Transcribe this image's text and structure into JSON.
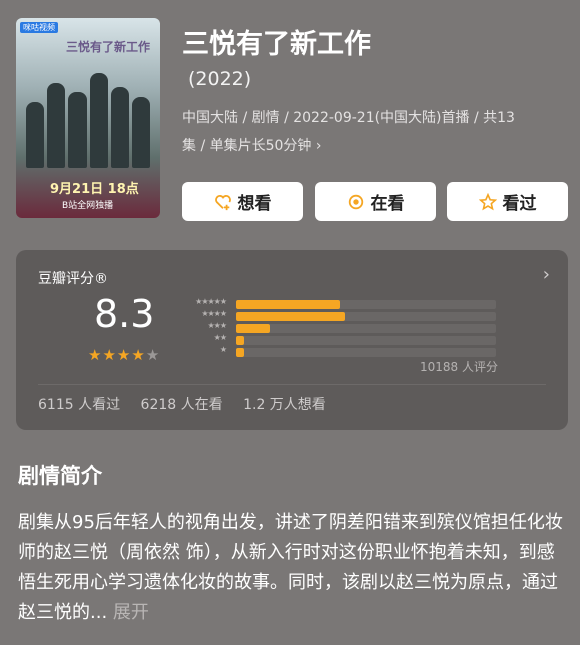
{
  "poster": {
    "tag": "咪咕视频",
    "title": "三悦有了新工作",
    "date": "9月21日 18点",
    "sub": "B站全网独播"
  },
  "header": {
    "title": "三悦有了新工作",
    "year": "(2022)",
    "meta_line1": "中国大陆 / 剧情 / 2022-09-21(中国大陆)首播 / 共13",
    "meta_line2": "集 / 单集片长50分钟 ›"
  },
  "actions": [
    {
      "label": "想看",
      "icon": "heart-plus-icon"
    },
    {
      "label": "在看",
      "icon": "target-icon"
    },
    {
      "label": "看过",
      "icon": "star-outline-icon"
    }
  ],
  "rating": {
    "label": "豆瓣评分®",
    "score": "8.3",
    "stars": 4,
    "max_stars": 5,
    "distribution": [
      {
        "stars": 5,
        "fraction": 0.4
      },
      {
        "stars": 4,
        "fraction": 0.42
      },
      {
        "stars": 3,
        "fraction": 0.13
      },
      {
        "stars": 2,
        "fraction": 0.03
      },
      {
        "stars": 1,
        "fraction": 0.03
      }
    ],
    "count_text": "10188 人评分",
    "stats": [
      "6115 人看过",
      "6218 人在看",
      "1.2 万人想看"
    ]
  },
  "synopsis": {
    "title": "剧情简介",
    "text": "剧集从95后年轻人的视角出发，讲述了阴差阳错来到殡仪馆担任化妆师的赵三悦（周依然 饰），从新入行时对这份职业怀抱着未知，到感悟生死用心学习遗体化妆的故事。同时，该剧以赵三悦为原点，通过赵三悦的...",
    "more": "展开"
  },
  "colors": {
    "accent": "#f5a623",
    "background": "#7a7776",
    "card": "#5e5b5a"
  }
}
